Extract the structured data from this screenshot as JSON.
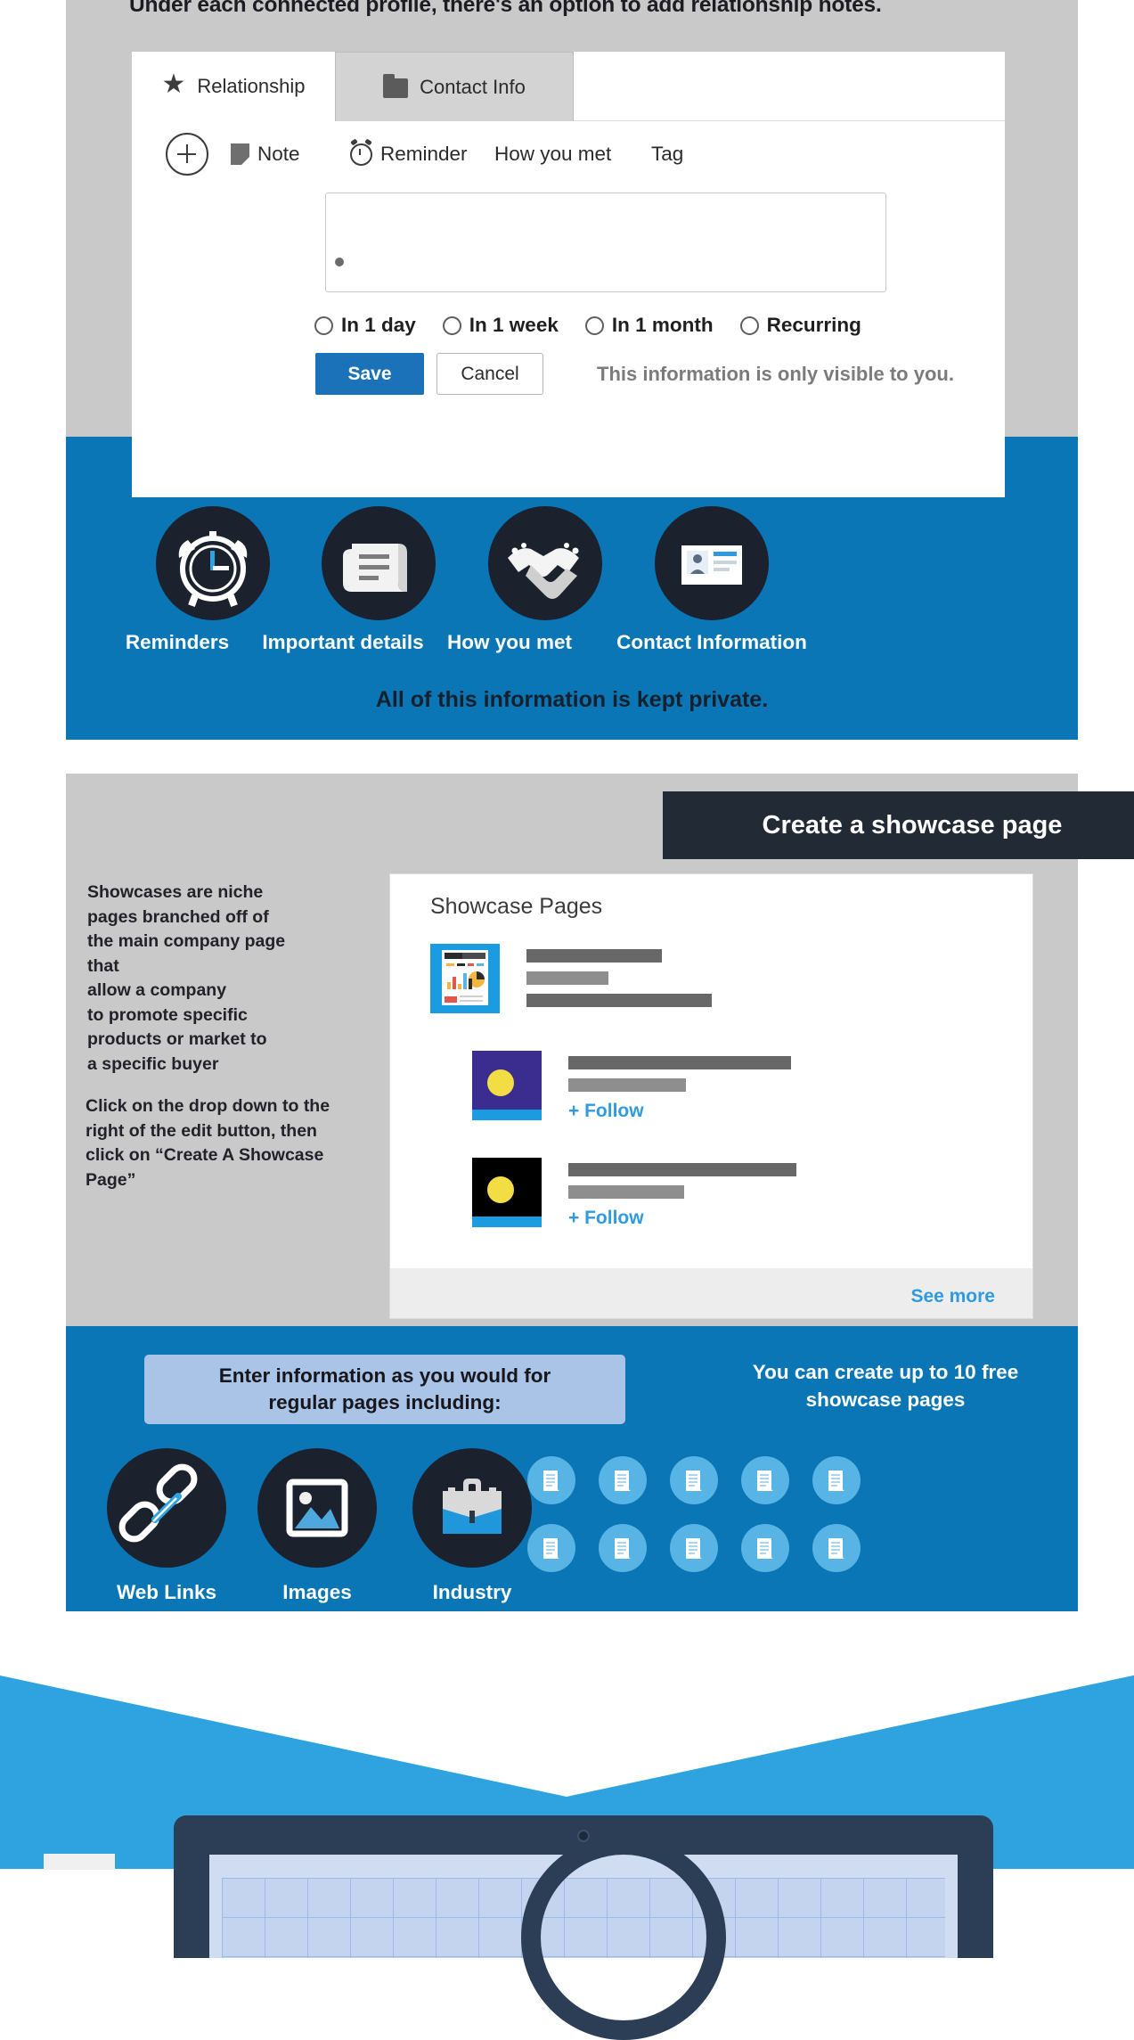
{
  "relationship_section": {
    "heading": "Under each connected profile, there's an option to add relationship notes.",
    "tabs": [
      {
        "label": "Relationship",
        "icon": "star-icon",
        "active": true
      },
      {
        "label": "Contact Info",
        "icon": "folder-icon",
        "active": false
      }
    ],
    "actions": [
      {
        "label": "Note",
        "icon": "note-icon"
      },
      {
        "label": "Reminder",
        "icon": "alarm-clock-icon"
      },
      {
        "label": "How you met",
        "icon": ""
      },
      {
        "label": "Tag",
        "icon": ""
      }
    ],
    "add_button": "+",
    "note_placeholder": "",
    "note_value": "",
    "reminder_options": [
      "In 1 day",
      "In 1 week",
      "In 1 month",
      "Recurring"
    ],
    "save_label": "Save",
    "cancel_label": "Cancel",
    "privacy_label": "This information is only visible to you.",
    "feature_icons": [
      {
        "label": "Reminders",
        "icon": "alarm-clock-icon"
      },
      {
        "label": "Important details",
        "icon": "document-scroll-icon"
      },
      {
        "label": "How you met",
        "icon": "handshake-icon"
      },
      {
        "label": "Contact Information",
        "icon": "contact-card-icon"
      }
    ],
    "footnote": "All of this information is kept private."
  },
  "showcase_section": {
    "header": "Create a showcase page",
    "text_block_1": "Showcases are niche\npages branched off of\nthe main company page that\nallow a company\nto promote specific\nproducts or market to\na specific buyer",
    "text_block_2": "Click on the drop down to the\nright of the edit button, then\nclick on “Create A Showcase\nPage”",
    "card": {
      "title": "Showcase Pages",
      "see_more": "See more",
      "items": [
        {
          "thumb": "dashboard-thumbnail",
          "follow": ""
        },
        {
          "thumb": "moon-purple-thumbnail",
          "follow": "+ Follow"
        },
        {
          "thumb": "moon-black-thumbnail",
          "follow": "+ Follow"
        }
      ]
    },
    "callout": "Enter information as you would for\nregular pages including:",
    "free_note": "You can create up to 10 free\nshowcase pages",
    "feature_icons": [
      {
        "label": "Web Links",
        "icon": "link-chain-icon"
      },
      {
        "label": "Images",
        "icon": "image-icon"
      },
      {
        "label": "Industry",
        "icon": "briefcase-icon"
      }
    ],
    "page_icon_count": 10,
    "page_icon_name": "document-page-icon"
  },
  "colors": {
    "brand_blue": "#0a76b5",
    "light_blue": "#2ea3e0",
    "dark_navy": "#1b222e",
    "header_navy": "#222a36",
    "grey_plate": "#c9c9c9",
    "link_blue": "#2f9ae0",
    "save_blue": "#1b72b8",
    "callout_blue": "#a9c4e6"
  }
}
